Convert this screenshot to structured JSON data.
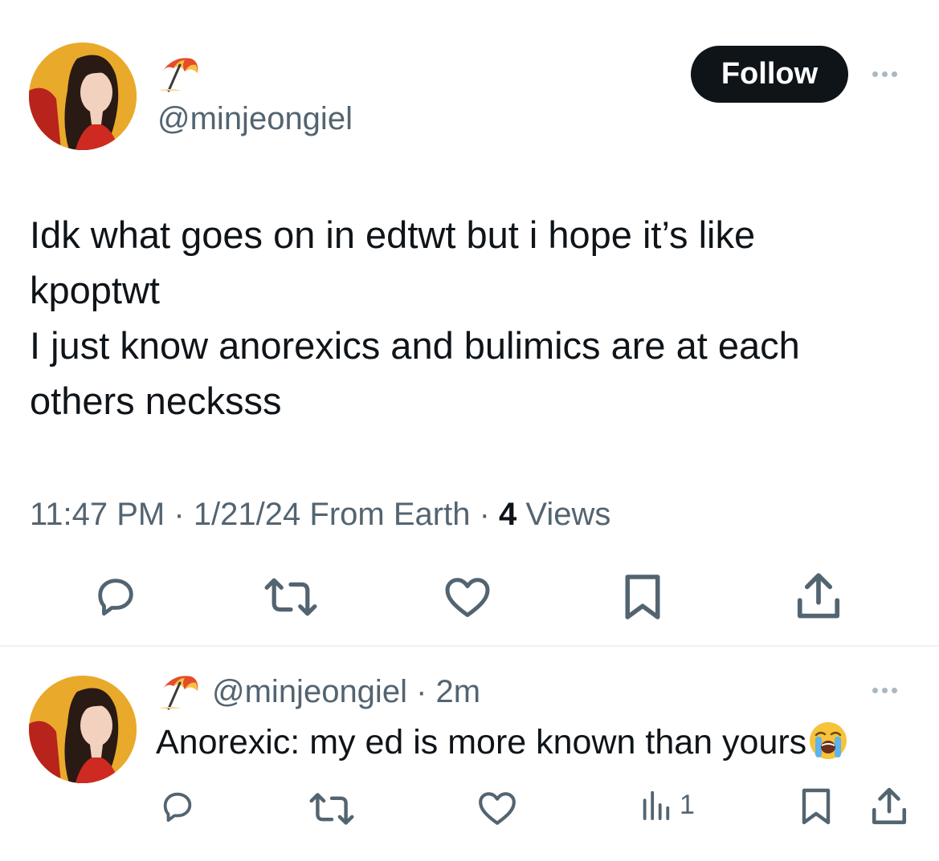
{
  "main_tweet": {
    "display_name_icon": "umbrella-on-ground-emoji",
    "handle": "@minjeongiel",
    "follow_label": "Follow",
    "text_lines": [
      "Idk what goes on in edtwt but i hope it’s like",
      "kpoptwt",
      "I just know anorexics and bulimics are at each",
      "others necksss"
    ],
    "time": "11:47 PM",
    "date": "1/21/24",
    "source": "From Earth",
    "separator": "·",
    "views_count": "4",
    "views_label": "Views",
    "actions": [
      "reply-icon",
      "retweet-icon",
      "like-icon",
      "bookmark-icon",
      "share-icon"
    ]
  },
  "reply": {
    "display_name_icon": "umbrella-on-ground-emoji",
    "handle": "@minjeongiel",
    "separator": "·",
    "age": "2m",
    "text": "Anorexic: my ed is more known than yours",
    "emoji": "loudly-crying-face-emoji",
    "views_count": "1",
    "actions": [
      "reply-icon",
      "retweet-icon",
      "like-icon",
      "views-icon",
      "bookmark-icon",
      "share-icon"
    ]
  },
  "colors": {
    "text_primary": "#0f1419",
    "text_secondary": "#536471",
    "icon_gray": "#536471",
    "button_black": "#0f1419",
    "divider": "#eff3f4"
  }
}
